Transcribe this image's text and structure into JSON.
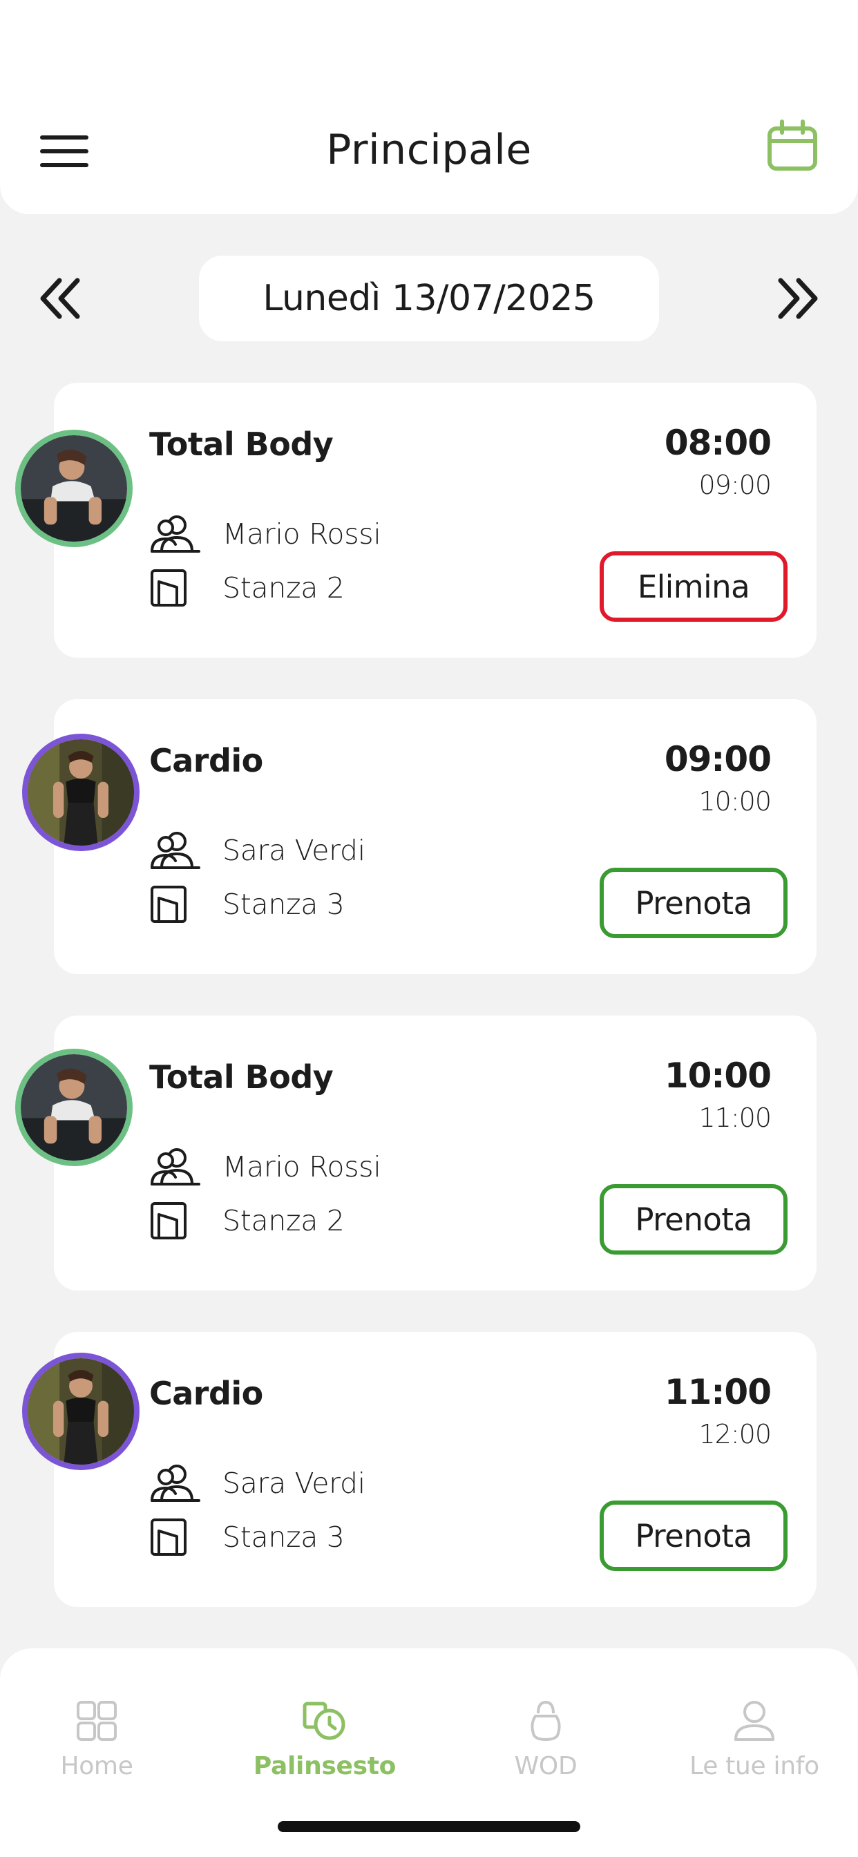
{
  "header": {
    "title": "Principale",
    "menu_icon": "hamburger-menu-icon",
    "calendar_icon": "calendar-icon"
  },
  "date_nav": {
    "date_label": "Lunedì 13/07/2025",
    "prev_icon": "double-chevron-left-icon",
    "next_icon": "double-chevron-right-icon"
  },
  "classes": [
    {
      "name": "Total Body",
      "instructor": "Mario Rossi",
      "room": "Stanza 2",
      "start": "08:00",
      "end": "09:00",
      "action": "Elimina",
      "action_type": "delete",
      "avatar_border": "#6cc084"
    },
    {
      "name": "Cardio",
      "instructor": "Sara Verdi",
      "room": "Stanza 3",
      "start": "09:00",
      "end": "10:00",
      "action": "Prenota",
      "action_type": "book",
      "avatar_border": "#7b55d6"
    },
    {
      "name": "Total Body",
      "instructor": "Mario Rossi",
      "room": "Stanza 2",
      "start": "10:00",
      "end": "11:00",
      "action": "Prenota",
      "action_type": "book",
      "avatar_border": "#6cc084"
    },
    {
      "name": "Cardio",
      "instructor": "Sara Verdi",
      "room": "Stanza 3",
      "start": "11:00",
      "end": "12:00",
      "action": "Prenota",
      "action_type": "book",
      "avatar_border": "#7b55d6"
    }
  ],
  "tabbar": {
    "tabs": [
      {
        "label": "Home",
        "icon": "grid-icon",
        "active": false
      },
      {
        "label": "Palinsesto",
        "icon": "schedule-icon",
        "active": true
      },
      {
        "label": "WOD",
        "icon": "kettlebell-icon",
        "active": false
      },
      {
        "label": "Le tue info",
        "icon": "user-icon",
        "active": false
      }
    ]
  },
  "colors": {
    "accent": "#8cc063",
    "book_border": "#3a9b32",
    "delete_border": "#e01a2a",
    "inactive_tab": "#c7c7c7",
    "background": "#f2f2f2"
  }
}
